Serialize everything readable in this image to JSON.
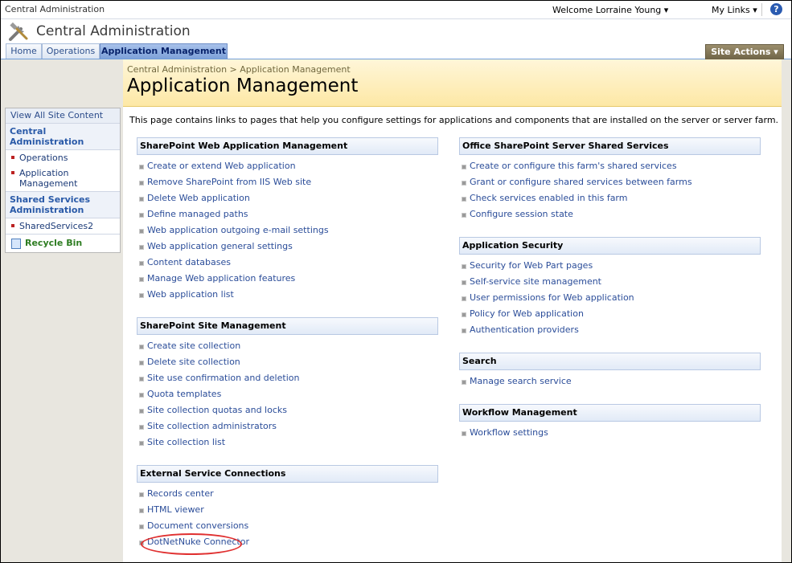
{
  "topbar": {
    "site": "Central Administration",
    "welcome": "Welcome Lorraine Young ▾",
    "mylinks": "My Links ▾",
    "help_icon": "help-icon"
  },
  "header": {
    "title": "Central Administration",
    "logo_icon": "tools-icon"
  },
  "tabs": [
    "Home",
    "Operations",
    "Application Management"
  ],
  "site_actions": "Site Actions ▾",
  "sidebar": {
    "view_all": "View All Site Content",
    "group1": "Central Administration",
    "group1_items": [
      "Operations",
      "Application Management"
    ],
    "group2": "Shared Services Administration",
    "group2_items": [
      "SharedServices2"
    ],
    "recycle": "Recycle Bin"
  },
  "breadcrumb": "Central Administration > Application Management",
  "page_title": "Application Management",
  "description": "This page contains links to pages that help you configure settings for applications and components that are installed on the server or server farm.",
  "sections": {
    "web_app": {
      "title": "SharePoint Web Application Management",
      "links": [
        "Create or extend Web application",
        "Remove SharePoint from IIS Web site",
        "Delete Web application",
        "Define managed paths",
        "Web application outgoing e-mail settings",
        "Web application general settings",
        "Content databases",
        "Manage Web application features",
        "Web application list"
      ]
    },
    "site_mgmt": {
      "title": "SharePoint Site Management",
      "links": [
        "Create site collection",
        "Delete site collection",
        "Site use confirmation and deletion",
        "Quota templates",
        "Site collection quotas and locks",
        "Site collection administrators",
        "Site collection list"
      ]
    },
    "external": {
      "title": "External Service Connections",
      "links": [
        "Records center",
        "HTML viewer",
        "Document conversions",
        "DotNetNuke Connector"
      ]
    },
    "shared": {
      "title": "Office SharePoint Server Shared Services",
      "links": [
        "Create or configure this farm's shared services",
        "Grant or configure shared services between farms",
        "Check services enabled in this farm",
        "Configure session state"
      ]
    },
    "security": {
      "title": "Application Security",
      "links": [
        "Security for Web Part pages",
        "Self-service site management",
        "User permissions for Web application",
        "Policy for Web application",
        "Authentication providers"
      ]
    },
    "search": {
      "title": "Search",
      "links": [
        "Manage search service"
      ]
    },
    "workflow": {
      "title": "Workflow Management",
      "links": [
        "Workflow settings"
      ]
    }
  },
  "colors": {
    "link": "#2b4d99",
    "title_band": "#fde8a5",
    "active_tab": "#7ea1d9",
    "highlight_circle": "#e03030"
  }
}
